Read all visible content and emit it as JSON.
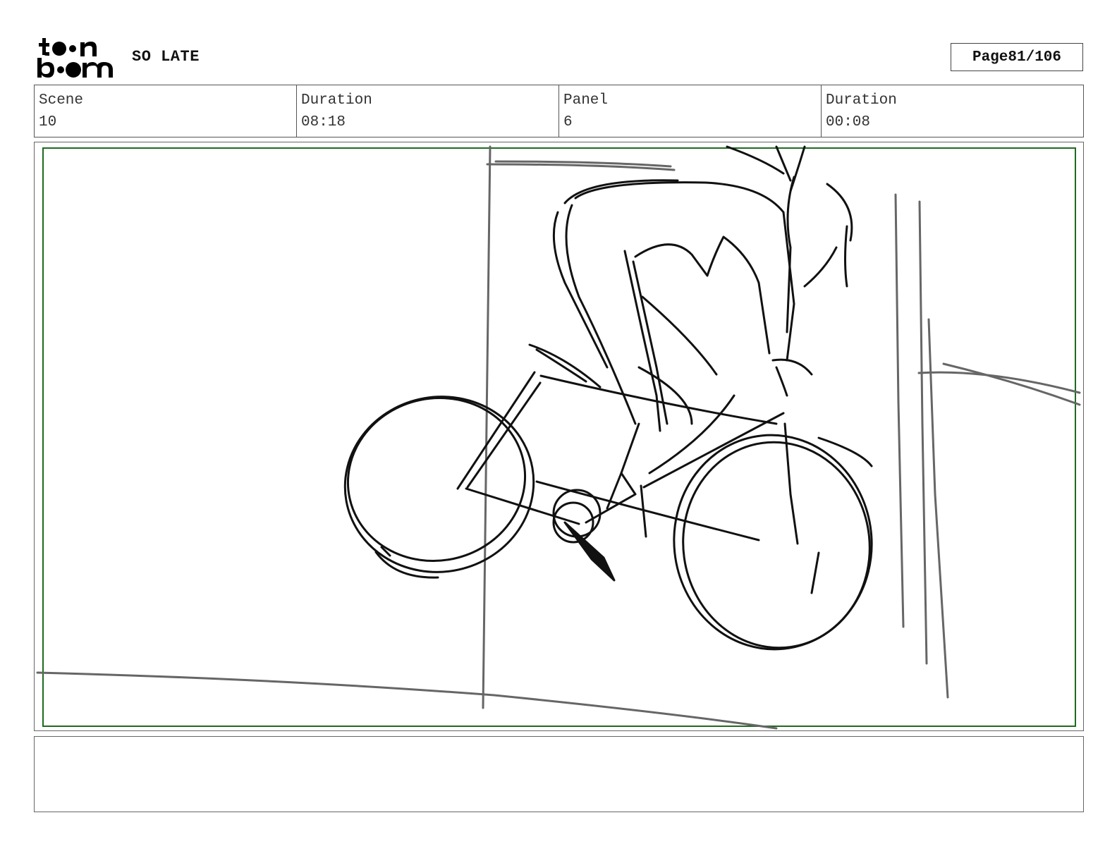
{
  "header": {
    "project_title": "SO LATE",
    "page_label": "Page",
    "page_value": "81/106",
    "logo_text_top": "toon",
    "logo_text_bottom": "boom"
  },
  "info": {
    "scene_label": "Scene",
    "scene_value": "10",
    "scene_duration_label": "Duration",
    "scene_duration_value": "08:18",
    "panel_label": "Panel",
    "panel_value": "6",
    "panel_duration_label": "Duration",
    "panel_duration_value": "00:08"
  },
  "panel": {
    "safe_frame_color": "#1e6b1e",
    "sketch_color": "#111111",
    "guide_color": "#666666"
  },
  "notes": {
    "text": ""
  }
}
